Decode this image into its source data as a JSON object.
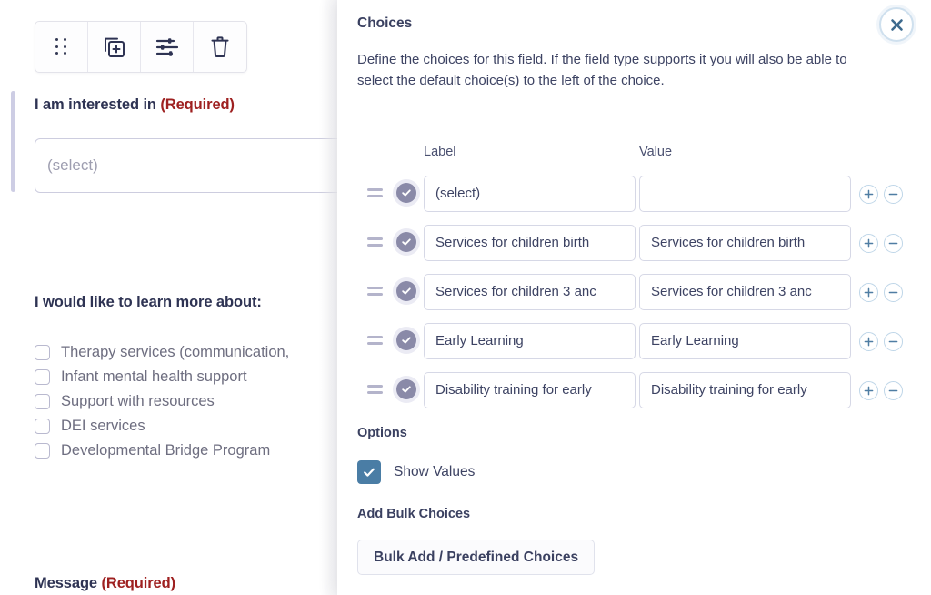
{
  "form_preview": {
    "toolbar": {
      "buttons": [
        {
          "name": "drag-handle",
          "label": "Drag"
        },
        {
          "name": "duplicate",
          "label": "Duplicate"
        },
        {
          "name": "settings",
          "label": "Settings"
        },
        {
          "name": "delete",
          "label": "Delete"
        }
      ]
    },
    "field_interested": {
      "label": "I am interested in",
      "required_text": "(Required)",
      "select_placeholder": "(select)"
    },
    "field_learn_more": {
      "label": "I would like to learn more about:",
      "options": [
        "Therapy services (communication,",
        "Infant mental health support",
        "Support with resources",
        "DEI services",
        "Developmental Bridge Program"
      ]
    },
    "field_message": {
      "label": "Message",
      "required_text": "(Required)"
    }
  },
  "panel": {
    "title": "Choices",
    "description": "Define the choices for this field. If the field type supports it you will also be able to select the default choice(s) to the left of the choice.",
    "close_label": "Close",
    "columns": {
      "label": "Label",
      "value": "Value"
    },
    "rows": [
      {
        "label": "(select)",
        "value": ""
      },
      {
        "label": "Services for children birth",
        "value": "Services for children birth"
      },
      {
        "label": "Services for children 3 anc",
        "value": "Services for children 3 anc"
      },
      {
        "label": "Early Learning",
        "value": "Early Learning"
      },
      {
        "label": "Disability training for early",
        "value": "Disability training for early"
      }
    ],
    "options_heading": "Options",
    "show_values_label": "Show Values",
    "show_values_checked": true,
    "bulk_heading": "Add Bulk Choices",
    "bulk_button_label": "Bulk Add / Predefined Choices"
  },
  "colors": {
    "accent_purple": "#cdcde4",
    "required_red": "#9e2020",
    "checkbox_blue": "#4a7da5",
    "choice_check_fill": "#8a8aa8",
    "text_dark": "#2e3353",
    "border_light": "#d6d8e6"
  }
}
